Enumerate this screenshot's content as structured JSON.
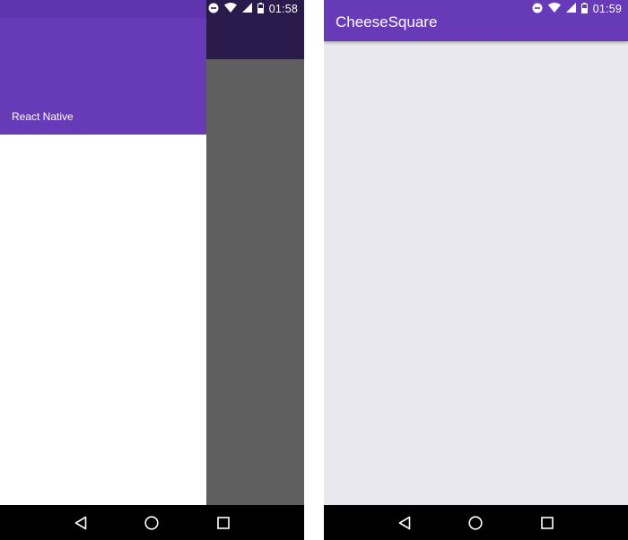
{
  "left_screen": {
    "status_bar": {
      "time": "01:58",
      "icons": [
        "do-not-disturb-icon",
        "wifi-icon",
        "signal-icon",
        "battery-icon"
      ]
    },
    "drawer": {
      "header_title": "React Native"
    },
    "nav_bar": {
      "buttons": [
        "back-icon",
        "home-icon",
        "recents-icon"
      ]
    }
  },
  "right_screen": {
    "status_bar": {
      "time": "01:59",
      "icons": [
        "do-not-disturb-icon",
        "wifi-icon",
        "signal-icon",
        "battery-icon"
      ]
    },
    "app_bar": {
      "title": "CheeseSquare"
    },
    "nav_bar": {
      "buttons": [
        "back-icon",
        "home-icon",
        "recents-icon"
      ]
    }
  },
  "colors": {
    "primary": "#673ab7",
    "primary_dark": "#5e31a8",
    "scrim": "#5f5f5f",
    "background": "#e9e8ee"
  }
}
